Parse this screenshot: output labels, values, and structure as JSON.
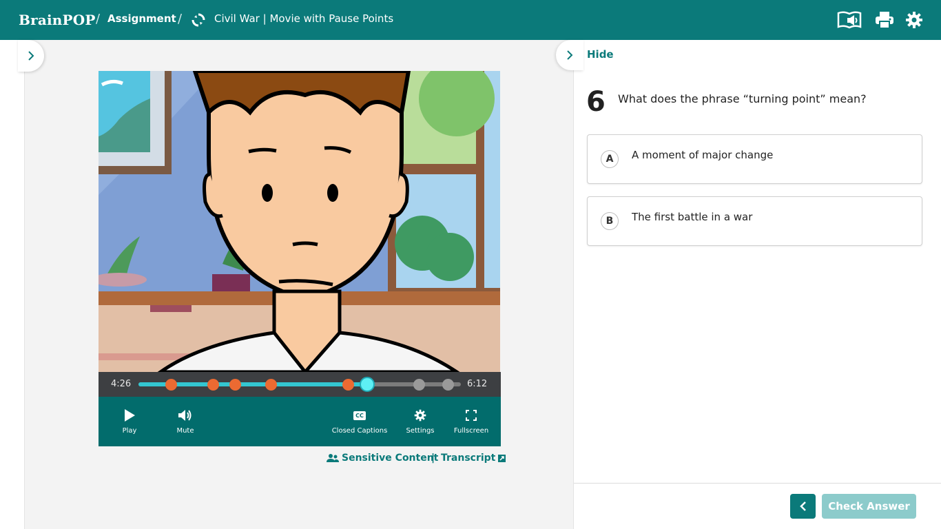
{
  "header": {
    "logo_text": "BrainPOP",
    "breadcrumb_sep": "/",
    "assignment_label": "Assignment",
    "title": "Civil War | Movie with Pause Points",
    "icons": [
      "read-aloud-icon",
      "print-icon",
      "settings-gear-icon"
    ]
  },
  "player": {
    "current_time": "4:26",
    "total_time": "6:12",
    "progress_fraction": 0.71,
    "pause_points": [
      {
        "fraction": 0.1,
        "state": "answered"
      },
      {
        "fraction": 0.23,
        "state": "answered"
      },
      {
        "fraction": 0.3,
        "state": "answered"
      },
      {
        "fraction": 0.41,
        "state": "answered"
      },
      {
        "fraction": 0.65,
        "state": "answered"
      },
      {
        "fraction": 0.87,
        "state": "upcoming"
      },
      {
        "fraction": 0.96,
        "state": "upcoming"
      }
    ],
    "controls": {
      "play": "Play",
      "mute": "Mute",
      "captions": "Closed Captions",
      "settings": "Settings",
      "fullscreen": "Fullscreen"
    },
    "captions_icon_text": "CC"
  },
  "links": {
    "sensitive": "Sensitive Content",
    "divider": "|",
    "transcript": "Transcript"
  },
  "panel": {
    "hide_label": "Hide",
    "question_number": "6",
    "question_text": "What does the phrase “turning point” mean?",
    "answers": [
      {
        "letter": "A",
        "text": "A moment of major change"
      },
      {
        "letter": "B",
        "text": "The first battle in a war"
      }
    ],
    "check_label": "Check Answer"
  },
  "colors": {
    "brand_teal": "#0b7a7a",
    "progress_cyan": "#33c6d1",
    "answered_marker": "#ec6a32",
    "upcoming_marker": "#9a9a9a"
  }
}
